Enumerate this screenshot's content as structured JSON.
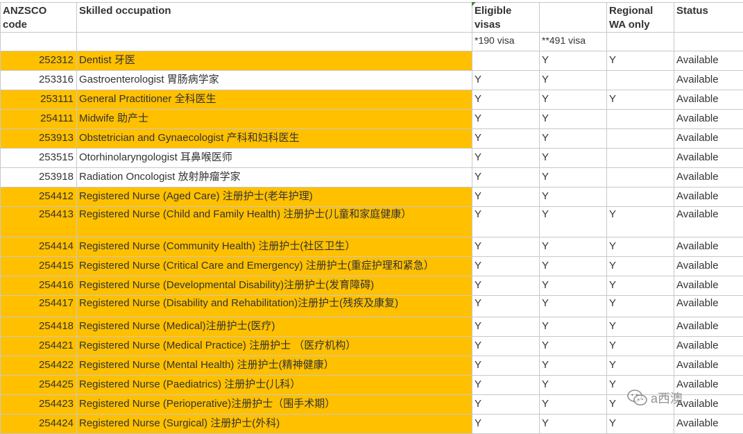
{
  "headers": {
    "code": "ANZSCO code",
    "occupation": "Skilled occupation",
    "eligible": "Eligible visas",
    "regional": "Regional WA only",
    "status": "Status",
    "visa190": "*190 visa",
    "visa491": "**491 visa"
  },
  "rows": [
    {
      "code": "252312",
      "occupation": "Dentist  牙医",
      "v190": "",
      "v491": "Y",
      "regional": "Y",
      "status": "Available",
      "highlight": true
    },
    {
      "code": "253316",
      "occupation": "Gastroenterologist   胃肠病学家",
      "v190": "Y",
      "v491": "Y",
      "regional": "",
      "status": "Available",
      "highlight": false
    },
    {
      "code": "253111",
      "occupation": "General Practitioner   全科医生",
      "v190": "Y",
      "v491": "Y",
      "regional": "Y",
      "status": "Available",
      "highlight": true
    },
    {
      "code": "254111",
      "occupation": "Midwife   助产士",
      "v190": "Y",
      "v491": "Y",
      "regional": "",
      "status": "Available",
      "highlight": true
    },
    {
      "code": "253913",
      "occupation": "Obstetrician and Gynaecologist  产科和妇科医生",
      "v190": "Y",
      "v491": "Y",
      "regional": "",
      "status": "Available",
      "highlight": true
    },
    {
      "code": "253515",
      "occupation": "Otorhinolaryngologist  耳鼻喉医师",
      "v190": "Y",
      "v491": "Y",
      "regional": "",
      "status": "Available",
      "highlight": false
    },
    {
      "code": "253918",
      "occupation": "Radiation Oncologist  放射肿瘤学家",
      "v190": "Y",
      "v491": "Y",
      "regional": "",
      "status": "Available",
      "highlight": false
    },
    {
      "code": "254412",
      "occupation": "Registered Nurse (Aged Care)  注册护士(老年护理)",
      "v190": "Y",
      "v491": "Y",
      "regional": "",
      "status": "Available",
      "highlight": true
    },
    {
      "code": "254413",
      "occupation": "Registered Nurse (Child and Family Health)   注册护士(儿童和家庭健康）",
      "v190": "Y",
      "v491": "Y",
      "regional": "Y",
      "status": "Available",
      "highlight": true
    },
    {
      "code": "254414",
      "occupation": "Registered Nurse (Community Health)  注册护士(社区卫生）",
      "v190": "Y",
      "v491": "Y",
      "regional": "Y",
      "status": "Available",
      "highlight": true
    },
    {
      "code": "254415",
      "occupation": "Registered Nurse (Critical Care and Emergency)  注册护士(重症护理和紧急）",
      "v190": "Y",
      "v491": "Y",
      "regional": "Y",
      "status": "Available",
      "highlight": true
    },
    {
      "code": "254416",
      "occupation": "Registered Nurse (Developmental Disability)注册护士(发育障碍)",
      "v190": "Y",
      "v491": "Y",
      "regional": "Y",
      "status": "Available",
      "highlight": true
    },
    {
      "code": "254417",
      "occupation": "Registered Nurse (Disability and Rehabilitation)注册护士(残疾及康复)",
      "v190": "Y",
      "v491": "Y",
      "regional": "Y",
      "status": "Available",
      "highlight": true
    },
    {
      "code": "254418",
      "occupation": "Registered Nurse (Medical)注册护士(医疗)",
      "v190": "Y",
      "v491": "Y",
      "regional": "Y",
      "status": "Available",
      "highlight": true
    },
    {
      "code": "254421",
      "occupation": "Registered Nurse (Medical Practice)  注册护士 （医疗机构）",
      "v190": "Y",
      "v491": "Y",
      "regional": "Y",
      "status": "Available",
      "highlight": true
    },
    {
      "code": "254422",
      "occupation": "Registered Nurse (Mental Health)  注册护士(精神健康）",
      "v190": "Y",
      "v491": "Y",
      "regional": "Y",
      "status": "Available",
      "highlight": true
    },
    {
      "code": "254425",
      "occupation": "Registered Nurse (Paediatrics)  注册护士(儿科）",
      "v190": "Y",
      "v491": "Y",
      "regional": "Y",
      "status": "Available",
      "highlight": true
    },
    {
      "code": "254423",
      "occupation": "Registered Nurse (Perioperative)注册护士（围手术期）",
      "v190": "Y",
      "v491": "Y",
      "regional": "Y",
      "status": "Available",
      "highlight": true
    },
    {
      "code": "254424",
      "occupation": "Registered Nurse (Surgical)  注册护士(外科)",
      "v190": "Y",
      "v491": "Y",
      "regional": "Y",
      "status": "Available",
      "highlight": true
    }
  ],
  "watermark": {
    "text": "a西澳",
    "icon": "wechat-icon"
  },
  "colors": {
    "highlight": "#ffc000",
    "grid": "#c8c8c8"
  }
}
